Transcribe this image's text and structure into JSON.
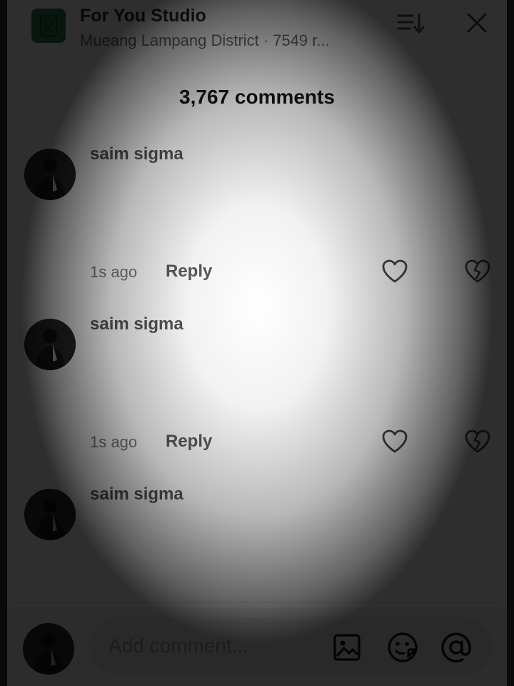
{
  "header": {
    "studio_title": "For You Studio",
    "studio_subtitle": "Mueang Lampang District · 7549 r...",
    "logo_icon": "studio-logo-icon",
    "sort_icon": "sort-icon",
    "close_icon": "close-icon"
  },
  "comments_header": {
    "count_label": "3,767 comments"
  },
  "comments": [
    {
      "username": "saim sigma",
      "timestamp": "1s ago",
      "reply_label": "Reply"
    },
    {
      "username": "saim sigma",
      "timestamp": "1s ago",
      "reply_label": "Reply"
    },
    {
      "username": "saim sigma"
    }
  ],
  "composer": {
    "placeholder": "Add comment...",
    "value": "",
    "icons": [
      "image-icon",
      "emoji-icon",
      "at-icon"
    ]
  },
  "colors": {
    "logo_green": "#2c7a52",
    "text_dark": "#161616",
    "text_muted": "#7a7a7a"
  }
}
